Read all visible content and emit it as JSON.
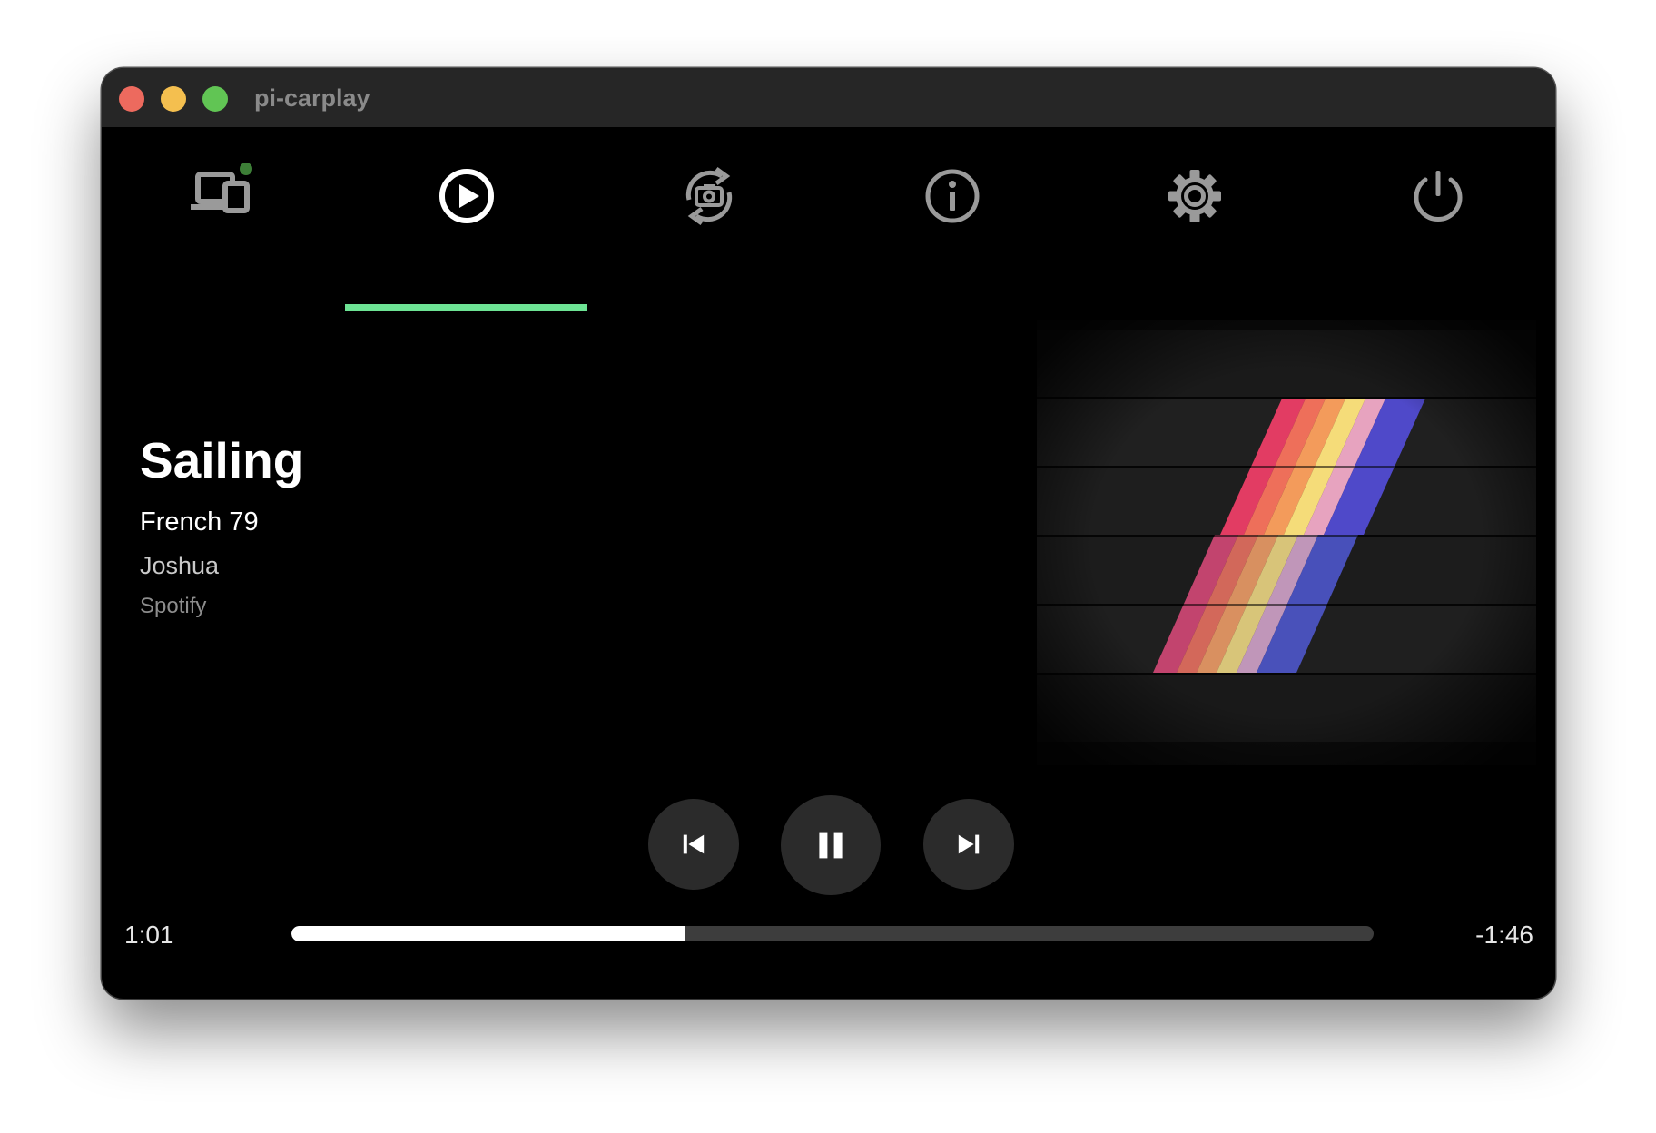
{
  "window": {
    "title": "pi-carplay"
  },
  "tabs": [
    {
      "name": "devices",
      "icon": "devices-icon",
      "status_color": "#3d7f37"
    },
    {
      "name": "media",
      "icon": "play-circle-icon",
      "active": true
    },
    {
      "name": "camera",
      "icon": "camera-rotate-icon"
    },
    {
      "name": "info",
      "icon": "info-icon"
    },
    {
      "name": "settings",
      "icon": "gear-icon"
    },
    {
      "name": "power",
      "icon": "power-icon"
    }
  ],
  "now_playing": {
    "title": "Sailing",
    "album": "French 79",
    "artist": "Joshua",
    "source": "Spotify"
  },
  "controls": {
    "previous_icon": "skip-previous-icon",
    "pause_icon": "pause-icon",
    "next_icon": "skip-next-icon"
  },
  "playback": {
    "elapsed": "1:01",
    "remaining": "-1:46",
    "progress_percent": 36.4
  },
  "colors": {
    "accent": "#6de394",
    "window_background": "#000000",
    "titlebar": "#262626",
    "control_background": "#2b2b2b"
  }
}
